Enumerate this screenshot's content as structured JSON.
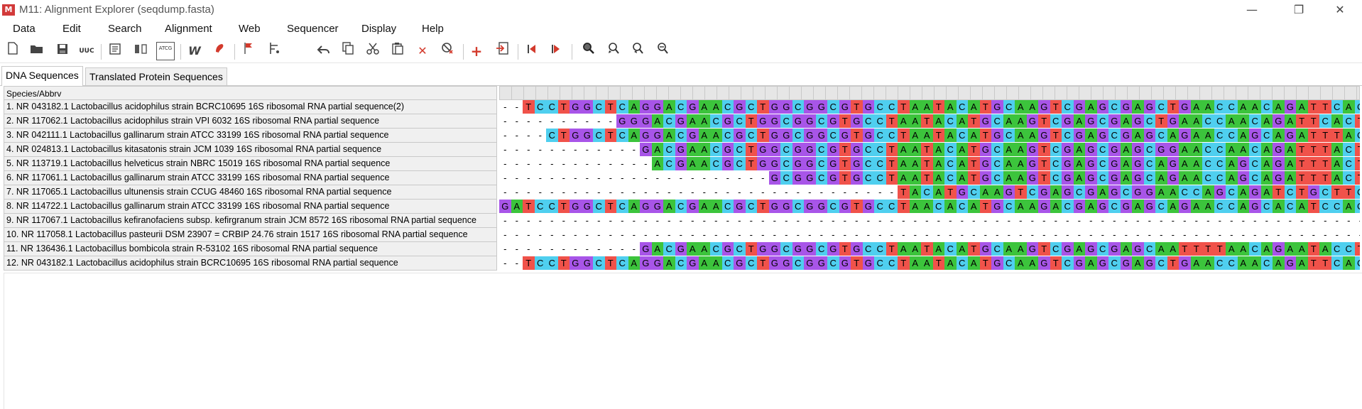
{
  "window": {
    "app_icon": "M",
    "title": "M11: Alignment Explorer (seqdump.fasta)",
    "minimize": "—",
    "maximize": "❐",
    "close": "✕"
  },
  "menu": [
    "Data",
    "Edit",
    "Search",
    "Alignment",
    "Web",
    "Sequencer",
    "Display",
    "Help"
  ],
  "toolbar": {
    "icons": [
      "new-file-icon",
      "open-folder-icon",
      "save-icon",
      "uppercase-icon",
      "edit-sequence-icon",
      "sequence-split-icon",
      "atcg-icon",
      "align-w-icon",
      "align-muscle-icon",
      "mark-site-icon",
      "mark-range-icon",
      "undo-icon",
      "copy-icon",
      "cut-icon",
      "paste-icon",
      "delete-icon",
      "delete-gap-icon",
      "add-sequence-icon",
      "import-icon",
      "previous-site-icon",
      "next-site-icon",
      "search-icon",
      "find-previous-icon",
      "find-next-icon",
      "find-motif-icon"
    ],
    "uppercase_label": "UUC",
    "atcg_label": "ATCG"
  },
  "tabs": [
    {
      "label": "DNA Sequences",
      "active": true
    },
    {
      "label": "Translated Protein Sequences",
      "active": false
    }
  ],
  "grid": {
    "header": "Species/Abbrv",
    "colors": {
      "A": "#3cc43c",
      "C": "#4fcfef",
      "G": "#a855e8",
      "T": "#f0524a"
    },
    "rows": [
      {
        "name": "1. NR 043182.1 Lactobacillus acidophilus strain BCRC10695 16S ribosomal RNA partial sequence(2)",
        "seq": "--TCCTGGCTCAGGACGAACGCTGGCGGCGTGCCTAATACATGCAAGTCGAGCGAGCTGAACCAACAGATTCACTTCGGTG"
      },
      {
        "name": "2. NR 117062.1 Lactobacillus acidophilus strain VPI 6032 16S ribosomal RNA partial sequence",
        "seq": "----------GGGACGAACGCTGGCGGCGTGCCTAATACATGCAAGTCGAGCGAGCTGAACCAACAGATTCACTTCGGTG"
      },
      {
        "name": "3. NR 042111.1 Lactobacillus gallinarum strain ATCC 33199 16S ribosomal RNA partial sequence",
        "seq": "----CTGGCTCAGGACGAACGCTGGCGGCGTGCCTAATACATGCAAGTCGAGCGAGCAGAACCAGCAGATTTACTTCGGTA"
      },
      {
        "name": "4. NR 024813.1 Lactobacillus kitasatonis strain JCM 1039 16S ribosomal RNA partial sequence",
        "seq": "------------GACGAACGCTGGCGGCGTGCCTAATACATGCAAGTCGAGCGAGCGGAACCAACAGATTTACTTCGGTA"
      },
      {
        "name": "5. NR 113719.1 Lactobacillus helveticus strain NBRC 15019 16S ribosomal RNA partial sequence",
        "seq": "-------------ACGAACGCTGGCGGCGTGCCTAATACATGCAAGTCGAGCGAGCAGAACCAGCAGATTTACTTCGGTA"
      },
      {
        "name": "6. NR 117061.1 Lactobacillus gallinarum strain ATCC 33199 16S ribosomal RNA partial sequence",
        "seq": "-----------------------GCGGCGTGCCTAATACATGCAAGTCGAGCGAGCAGAACCAGCAGATTTACTTCGGTA"
      },
      {
        "name": "7. NR 117065.1 Lactobacillus ultunensis strain CCUG 48460 16S ribosomal RNA partial sequence",
        "seq": "----------------------------------TACATGCAAGTCGAGCGAGCGGAACCAGCAGATCTGCTTCGGCA"
      },
      {
        "name": "8. NR 114722.1 Lactobacillus gallinarum strain ATCC 33199 16S ribosomal RNA partial sequence",
        "seq": "GATCCTGGCTCAGGACGAACGCTGGCGGCGTGCCTAACACATGCAAGACGAGCGAGCAGAACCAGCACATCCACTTCGGTA"
      },
      {
        "name": "9. NR 117067.1 Lactobacillus kefiranofaciens subsp. kefirgranum strain JCM 8572 16S ribosomal RNA partial sequence",
        "seq": "------------------------------------------------------------------------------------"
      },
      {
        "name": "10. NR 117058.1 Lactobacillus pasteurii DSM 23907 = CRBIP 24.76 strain 1517 16S ribosomal RNA partial sequence",
        "seq": "------------------------------------------------------------------------------------"
      },
      {
        "name": "11. NR 136436.1 Lactobacillus bombicola strain R-53102 16S ribosomal RNA partial sequence",
        "seq": "------------GACGAACGCTGGCGGCGTGCCTAATACATGCAAGTCGAGCGAGCAATTTTAACAGAATACCTTCGGGT"
      },
      {
        "name": "12. NR 043182.1 Lactobacillus acidophilus strain BCRC10695 16S ribosomal RNA partial sequence",
        "seq": "--TCCTGGCTCAGGACGAACGCTGGCGGCGTGCCTAATACATGCAAGTCGAGCGAGCTGAACCAACAGATTCACTTCGGTG"
      }
    ]
  }
}
